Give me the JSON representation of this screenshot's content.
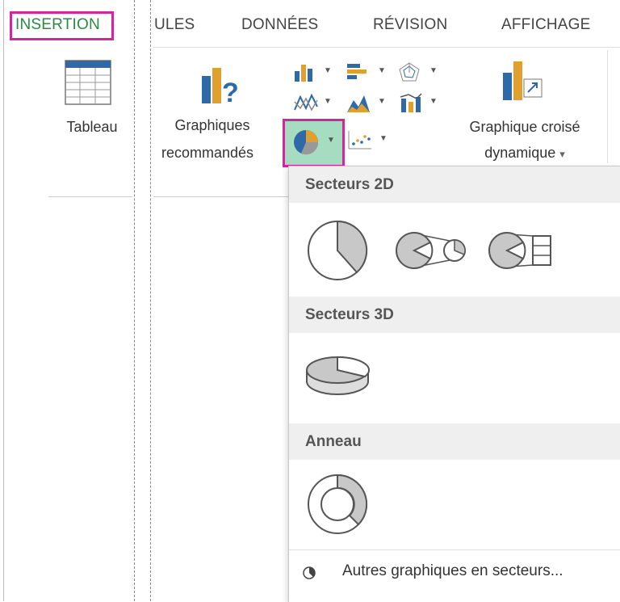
{
  "ribbon": {
    "tabs": [
      "INSERTION",
      "ULES",
      "DONNÉES",
      "RÉVISION",
      "AFFICHAGE"
    ],
    "table_label": "Tableau",
    "recommended_label_line1": "Graphiques",
    "recommended_label_line2": "recommandés",
    "pivot_label_line1": "Graphique croisé",
    "pivot_label_line2": "dynamique",
    "pivot_caret": "▾"
  },
  "dropdown": {
    "sections": [
      {
        "title": "Secteurs 2D",
        "items": [
          "pie-2d",
          "pie-of-pie",
          "bar-of-pie"
        ]
      },
      {
        "title": "Secteurs 3D",
        "items": [
          "pie-3d"
        ]
      },
      {
        "title": "Anneau",
        "items": [
          "doughnut"
        ]
      }
    ],
    "more_label": "Autres graphiques en secteurs..."
  },
  "colors": {
    "highlight": "#d6249e",
    "active_tab": "#2a8a44",
    "pie_fill": "#c8c8c8",
    "icon_blue": "#2f6aa8",
    "icon_orange": "#e0a030"
  }
}
